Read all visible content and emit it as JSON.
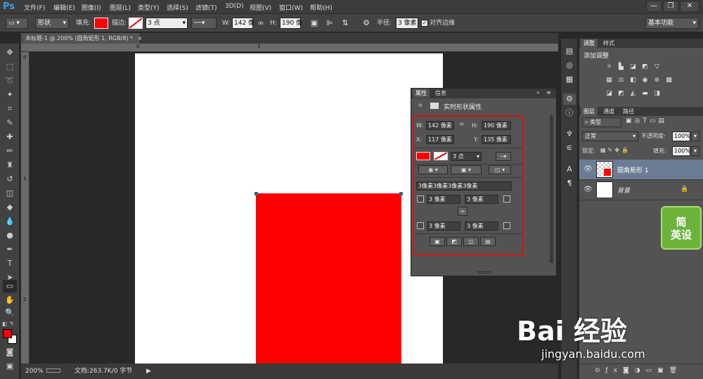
{
  "app": {
    "logo": "Ps"
  },
  "menu": [
    "文件(F)",
    "编辑(E)",
    "图像(I)",
    "图层(L)",
    "类型(Y)",
    "选择(S)",
    "滤镜(T)",
    "3D(D)",
    "视图(V)",
    "窗口(W)",
    "帮助(H)"
  ],
  "window_buttons": [
    "—",
    "❐",
    "✕"
  ],
  "options": {
    "mode": "形状",
    "fill_label": "填充:",
    "stroke_label": "描边:",
    "stroke_width": "3 点",
    "w_label": "W:",
    "w_value": "142 像",
    "h_label": "H:",
    "h_value": "190 像",
    "radius_label": "半径:",
    "radius_value": "3 像素",
    "align_edges": "对齐边缘",
    "workspace": "基本功能"
  },
  "document": {
    "tab_title": "未标题-1 @ 200% (圆角矩形 1, RGB/8) *",
    "close": "×"
  },
  "rulers": {
    "top": [
      "0",
      "1"
    ],
    "left": [
      "0",
      "1",
      "2"
    ]
  },
  "status": {
    "zoom": "200%",
    "doc_info": "文档:263.7K/0 字节",
    "arrow": "▶"
  },
  "colors": {
    "foreground": "#ff0000",
    "background": "#ffffff",
    "shape_fill": "#ff0000",
    "highlight_box": "#d31515",
    "selected_layer": "#6c7c94"
  },
  "properties": {
    "tabs": [
      "属性",
      "信息"
    ],
    "title": "实时形状属性",
    "w_label": "W:",
    "w_value": "142 像素",
    "h_label": "H:",
    "h_value": "190 像素",
    "x_label": "X:",
    "x_value": "117 像素",
    "y_label": "Y:",
    "y_value": "135 像素",
    "stroke_width": "3 点",
    "corner_summary": "3像素3像素3像素3像素",
    "corner_tl": "3 像素",
    "corner_tr": "3 像素",
    "corner_bl": "3 像素",
    "corner_br": "3 像素"
  },
  "adjustments": {
    "tabs": [
      "调整",
      "样式"
    ],
    "title": "添加调整"
  },
  "layers_panel": {
    "tabs": [
      "图层",
      "通道",
      "路径"
    ],
    "filter": "类型",
    "blend_mode": "正常",
    "opacity_label": "不透明度:",
    "opacity": "100%",
    "lock_label": "锁定:",
    "fill_label": "填充:",
    "fill": "100%",
    "layers": [
      {
        "name": "圆角矩形 1",
        "selected": true
      },
      {
        "name": "背景",
        "selected": false
      }
    ]
  },
  "watermarks": {
    "green_line1": "简",
    "green_line2": "英设",
    "baidu": "Bai 经验",
    "url": "jingyan.baidu.com"
  }
}
